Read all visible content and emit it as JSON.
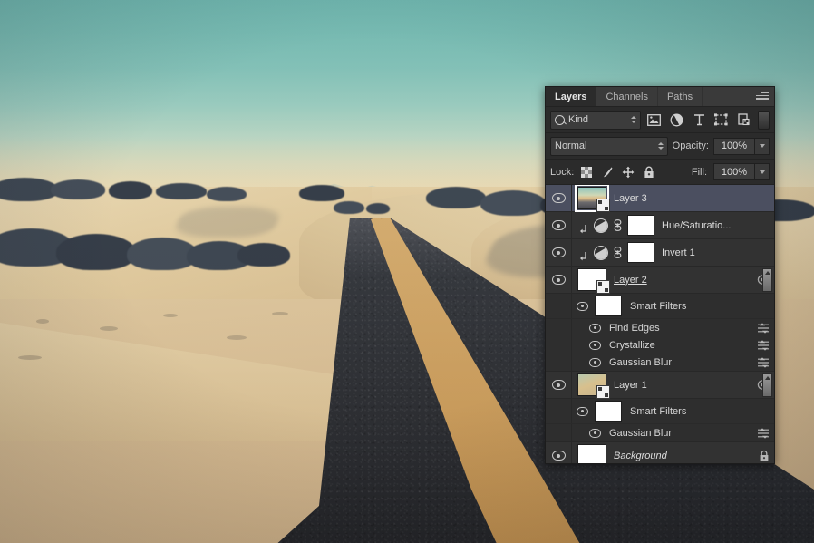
{
  "photo": {
    "description": "Desert highway at dusk with sand dunes and double yellow center lines",
    "sky_color": "#84c2b8",
    "sand_color": "#e0c89b",
    "road_color": "#2e3036",
    "line_color": "#d9ae6f"
  },
  "panel": {
    "tabs": [
      {
        "label": "Layers",
        "active": true
      },
      {
        "label": "Channels",
        "active": false
      },
      {
        "label": "Paths",
        "active": false
      }
    ],
    "menu_icon": "panel-menu-icon",
    "filter": {
      "kind_label": "Kind",
      "search_icon": "search-icon",
      "buttons": [
        {
          "icon": "pixel-layer-filter-icon",
          "name": "filter-pixel"
        },
        {
          "icon": "adjustment-layer-filter-icon",
          "name": "filter-adjustment"
        },
        {
          "icon": "type-layer-filter-icon",
          "name": "filter-type"
        },
        {
          "icon": "shape-layer-filter-icon",
          "name": "filter-shape"
        },
        {
          "icon": "smart-object-filter-icon",
          "name": "filter-smart-object"
        }
      ],
      "toggle_name": "filter-enable-toggle"
    },
    "blend": {
      "mode": "Normal",
      "opacity_label": "Opacity:",
      "opacity_value": "100%"
    },
    "lock": {
      "label": "Lock:",
      "icons": [
        {
          "name": "lock-transparent-pixels-icon"
        },
        {
          "name": "lock-image-pixels-icon"
        },
        {
          "name": "lock-position-icon"
        },
        {
          "name": "lock-all-icon"
        }
      ],
      "fill_label": "Fill:",
      "fill_value": "100%"
    },
    "layers": [
      {
        "type": "layer",
        "name": "Layer 3",
        "visible": true,
        "selected": true,
        "thumb": "photo",
        "smart_object": true,
        "underline": false,
        "italic": false
      },
      {
        "type": "adjustment",
        "name": "Hue/Saturatio...",
        "visible": true,
        "selected": false,
        "clipped": true,
        "linked": true,
        "mask": true
      },
      {
        "type": "adjustment",
        "name": "Invert 1",
        "visible": true,
        "selected": false,
        "clipped": true,
        "linked": true,
        "mask": true
      },
      {
        "type": "layer",
        "name": "Layer 2",
        "visible": true,
        "selected": false,
        "thumb": "white",
        "smart_object": true,
        "underline": true,
        "has_fx_badge": true,
        "scroll_thumb": true
      },
      {
        "type": "smart-filters",
        "name": "Smart Filters",
        "visible": true
      },
      {
        "type": "filter",
        "name": "Find Edges",
        "visible": true
      },
      {
        "type": "filter",
        "name": "Crystallize",
        "visible": true
      },
      {
        "type": "filter",
        "name": "Gaussian Blur",
        "visible": true
      },
      {
        "type": "layer",
        "name": "Layer 1",
        "visible": true,
        "selected": false,
        "thumb": "grad1",
        "smart_object": true,
        "underline": false,
        "has_fx_badge": true,
        "scroll_thumb": true
      },
      {
        "type": "smart-filters",
        "name": "Smart Filters",
        "visible": true
      },
      {
        "type": "filter",
        "name": "Gaussian Blur",
        "visible": true
      },
      {
        "type": "layer",
        "name": "Background",
        "visible": true,
        "selected": false,
        "thumb": "white",
        "italic": true,
        "locked": true
      }
    ]
  }
}
